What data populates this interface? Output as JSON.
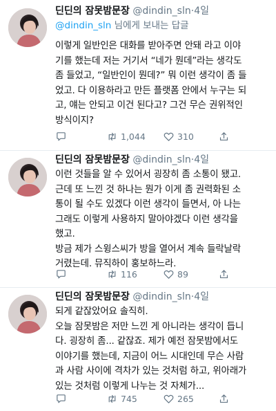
{
  "tweets": [
    {
      "name": "딘딘의 잠못밤문장",
      "handle": "@dindin_sln",
      "dot": "·",
      "date": "4일",
      "reply_mention": "@dindin_sln",
      "reply_suffix": " 님에게 보내는 답글",
      "lines": [
        "이렇게 일반인은 대화를 받아주면 안돼 라고 이야",
        "기를 했는데 저는 거기서 “네가 뭔데”라는 생각도",
        "좀 들었고, “일반인이 뭔데?” 뭐 이런 생각이 좀 들",
        "었고. 다 이용하라고 만든 플랫폼 안에서 누구는 되",
        "고, 얘는 안되고 이건 된다고? 그건 무슨 권위적인",
        "방식이지?"
      ],
      "replies": "",
      "retweets": "1,044",
      "likes": "310"
    },
    {
      "name": "딘딘의 잠못밤문장",
      "handle": "@dindin_sln",
      "dot": "·",
      "date": "4일",
      "lines": [
        "이런 것들을 알 수 있어서 굉장히 좀 소통이 됐고.",
        "근데 또 느낀 것 하나는 뭔가 이게 좀 권력화된 소",
        "통이 될 수도 있겠다 이런 생각이 들면서, 아 나는",
        "그래도 이렇게 사용하지 말아야겠다 이런 생각을",
        "했고.",
        "방금 제가 스윙스씨가 방을 열어서 계속 들락날락",
        "거렸는데. 뮤직하이 홍보하느라."
      ],
      "replies": "",
      "retweets": "116",
      "likes": "89"
    },
    {
      "name": "딘딘의 잠못밤문장",
      "handle": "@dindin_sln",
      "dot": "·",
      "date": "4일",
      "lines": [
        "되게 같잖았어요 솔직히.",
        "오늘 잠못밤은 저만 느낀 게 아니라는 생각이 듭니",
        "다. 굉장히 좀... 같잖죠. 제가 예전 잠못밤에서도",
        "이야기를 했는데, 지금이 어느 시대인데 무슨 사람",
        "과 사람 사이에 격차가 있는 것처럼 하고, 위아래가",
        "있는 것처럼 이렇게 나누는 것 자체가..."
      ],
      "replies": "",
      "retweets": "745",
      "likes": "265"
    }
  ],
  "icons": {
    "reply": "speech-bubble-icon",
    "retweet": "retweet-arrows-icon",
    "like": "heart-icon",
    "share": "share-upload-icon"
  },
  "colors": {
    "text": "#14171a",
    "secondary": "#657786",
    "link": "#1da1f2",
    "divider": "#e6ecf0"
  }
}
